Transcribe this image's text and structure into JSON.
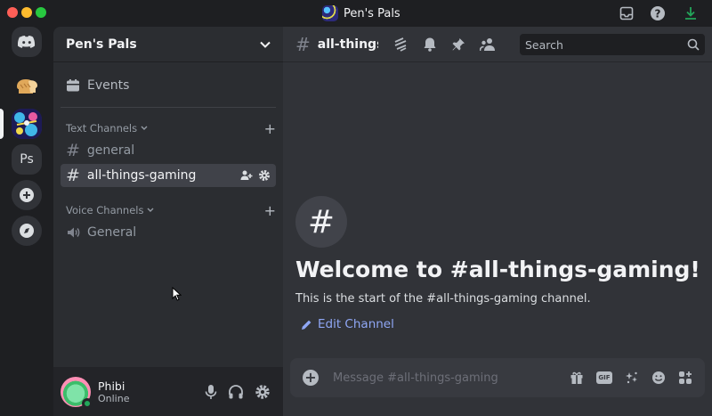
{
  "window": {
    "title": "Pen's Pals"
  },
  "rail": {
    "ps_label": "Ps"
  },
  "guild": {
    "name": "Pen's Pals",
    "events_label": "Events"
  },
  "categories": {
    "text": "Text Channels",
    "voice": "Voice Channels"
  },
  "channels": {
    "general": "general",
    "gaming": "all-things-gaming",
    "voice_general": "General"
  },
  "user": {
    "name": "Phibi",
    "status": "Online"
  },
  "header": {
    "channel_name": "all-things-gaming",
    "search_placeholder": "Search"
  },
  "welcome": {
    "title": "Welcome to #all-things-gaming!",
    "subtitle": "This is the start of the #all-things-gaming channel.",
    "edit_label": "Edit Channel"
  },
  "composer": {
    "placeholder": "Message #all-things-gaming",
    "gif_label": "GIF"
  },
  "colors": {
    "accent": "#5865f2",
    "online": "#23a55a",
    "link": "#8fa7f5"
  }
}
